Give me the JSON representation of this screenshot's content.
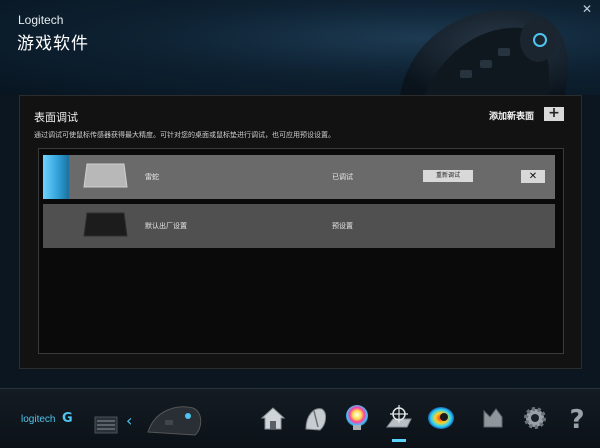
{
  "header": {
    "brand": "Logitech",
    "app_title": "游戏软件",
    "close_glyph": "✕"
  },
  "panel": {
    "title": "表面调试",
    "description": "通过调试可使鼠标传感器获得最大精度。可针对您的桌面或鼠标垫进行调试，也可应用预设设置。",
    "add_label": "添加新表面",
    "add_glyph": "+"
  },
  "surfaces": [
    {
      "name": "雷蛇",
      "status": "已调试",
      "recalibrate_label": "重新调试",
      "delete_glyph": "✕",
      "selected": true
    },
    {
      "name": "默认出厂设置",
      "status": "预设置",
      "selected": false
    }
  ],
  "bottom_bar": {
    "logo_text": "logitech",
    "logo_mark": "G",
    "back_glyph": "‹",
    "icons": [
      "home-icon",
      "pointer-settings-icon",
      "rgb-lighting-icon",
      "surface-tuning-icon",
      "heatmap-icon",
      "share-icon",
      "settings-gear-icon",
      "help-icon"
    ],
    "active_icon": "surface-tuning-icon"
  },
  "colors": {
    "accent": "#4fc4ee",
    "selected_row": "#6a6a6a",
    "row": "#505050",
    "panel_bg": "#121212"
  }
}
